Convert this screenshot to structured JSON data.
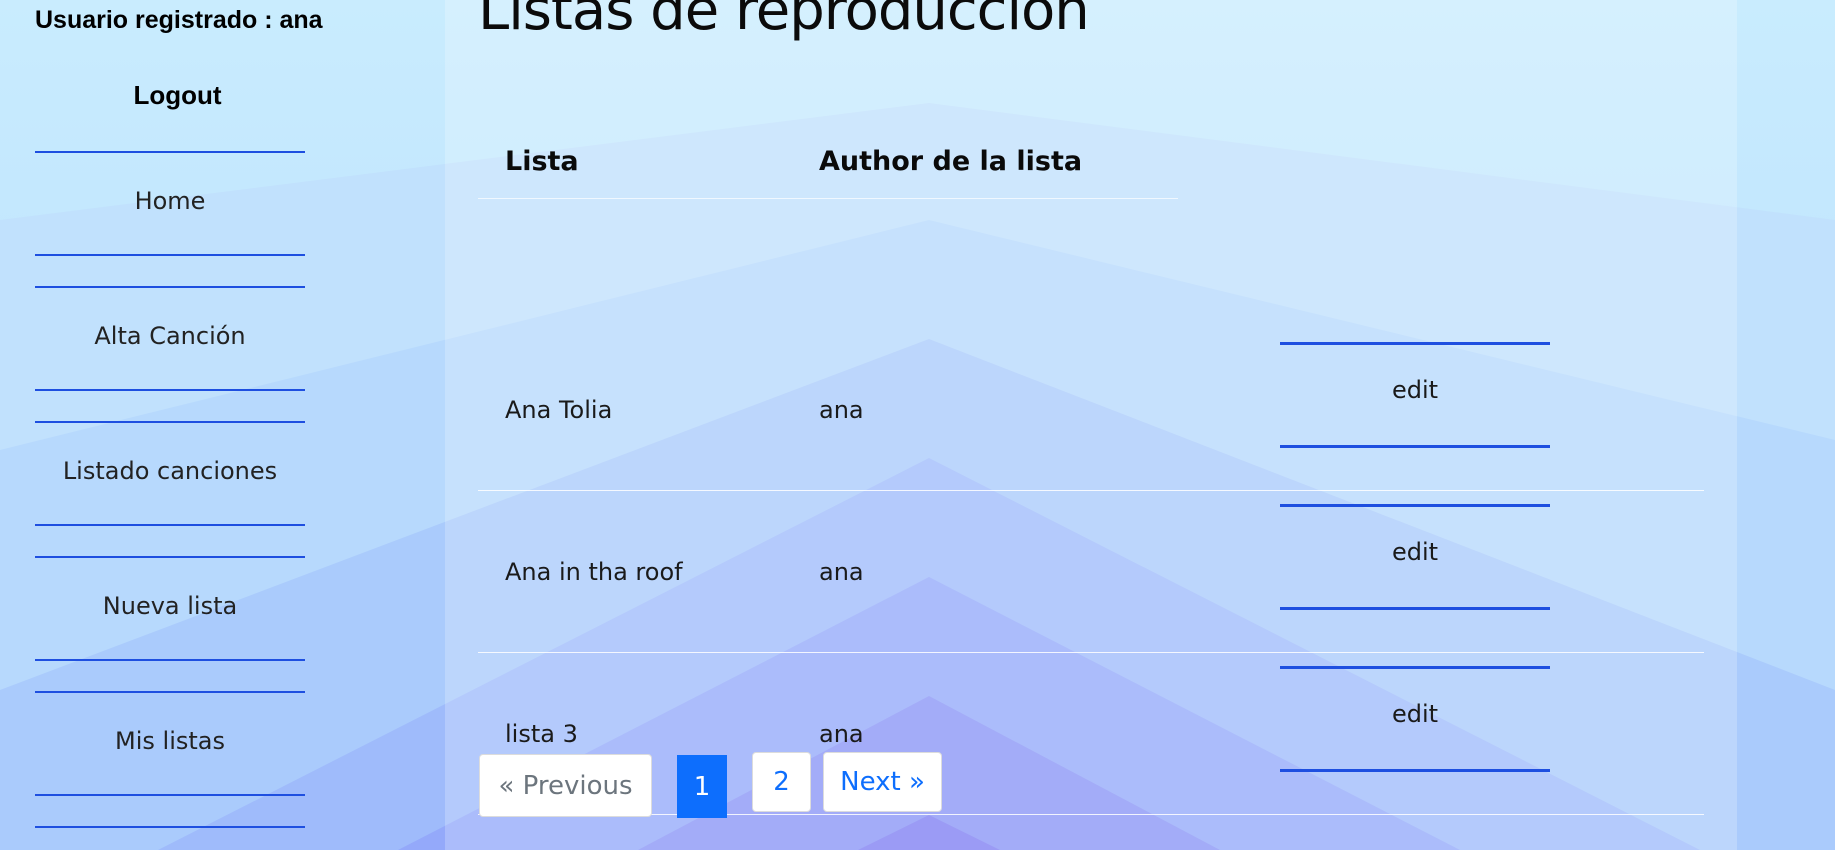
{
  "colors": {
    "accent": "#1e4fe0",
    "link": "#0d6efd",
    "background_light": "#cdeefe",
    "background_mid": "#9ebffb",
    "background_deep": "#7d6cf2"
  },
  "sidebar": {
    "user_label": "Usuario registrado : ana",
    "logout_label": "Logout",
    "items": [
      {
        "label": "Home"
      },
      {
        "label": "Alta Canción"
      },
      {
        "label": "Listado canciones"
      },
      {
        "label": "Nueva lista"
      },
      {
        "label": "Mis listas"
      }
    ]
  },
  "main": {
    "title": "Listas de reproducción",
    "table": {
      "headers": [
        "Lista",
        "Author de la lista"
      ],
      "rows": [
        {
          "lista": "Ana Tolia",
          "author": "ana",
          "action": "edit"
        },
        {
          "lista": "Ana in tha roof",
          "author": "ana",
          "action": "edit"
        },
        {
          "lista": "lista 3",
          "author": "ana",
          "action": "edit"
        }
      ]
    },
    "pagination": {
      "previous": "« Previous",
      "pages": [
        "1",
        "2"
      ],
      "current": "1",
      "next": "Next »"
    }
  }
}
